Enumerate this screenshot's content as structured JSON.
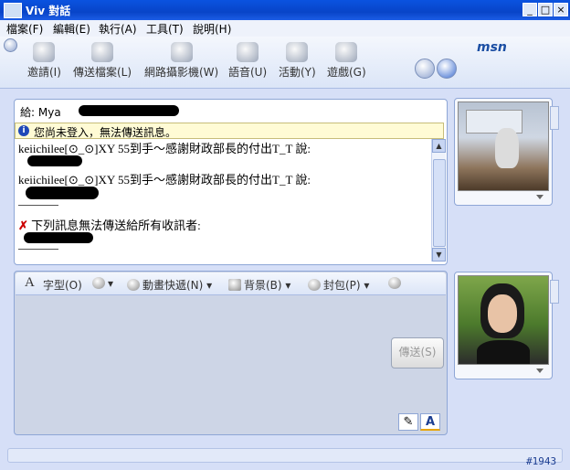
{
  "window": {
    "title": "對話",
    "title_obscured_prefix": "Viv",
    "buttons": [
      "_",
      "□",
      "×"
    ]
  },
  "menu": [
    "檔案(F)",
    "編輯(E)",
    "執行(A)",
    "工具(T)",
    "說明(H)"
  ],
  "toolbar": {
    "items": [
      {
        "label": "邀請(I)",
        "icon": "invite-icon"
      },
      {
        "label": "傳送檔案(L)",
        "icon": "send-file-icon"
      },
      {
        "label": "網路攝影機(W)",
        "icon": "webcam-icon"
      },
      {
        "label": "語音(U)",
        "icon": "voice-icon"
      },
      {
        "label": "活動(Y)",
        "icon": "activities-icon"
      },
      {
        "label": "遊戲(G)",
        "icon": "games-icon"
      }
    ],
    "brand": "msn"
  },
  "to": {
    "label": "給:",
    "name": "Mya"
  },
  "info": {
    "text": "您尚未登入，無法傳送訊息。"
  },
  "chat": {
    "messages": [
      {
        "sender": "keiichilee[⊙_⊙]XY 55到手～感謝財政部長的付出T_T 說:"
      },
      {
        "sender": "keiichilee[⊙_⊙]XY 55到手～感謝財政部長的付出T_T 說:"
      }
    ],
    "error": "下列訊息無法傳送給所有收訊者:"
  },
  "compose": {
    "tools": [
      {
        "label": "字型(O)",
        "icon": "font-icon"
      },
      {
        "label": "",
        "icon": "emoticon-icon"
      },
      {
        "label": "動畫快遞(N)",
        "icon": "wink-icon"
      },
      {
        "label": "背景(B)",
        "icon": "background-icon"
      },
      {
        "label": "封包(P)",
        "icon": "gift-icon"
      },
      {
        "label": "",
        "icon": "nudge-icon"
      }
    ],
    "send_label": "傳送(S)",
    "tab_handwrite": "✎",
    "tab_text": "A"
  },
  "status": {
    "text": "#1943"
  }
}
